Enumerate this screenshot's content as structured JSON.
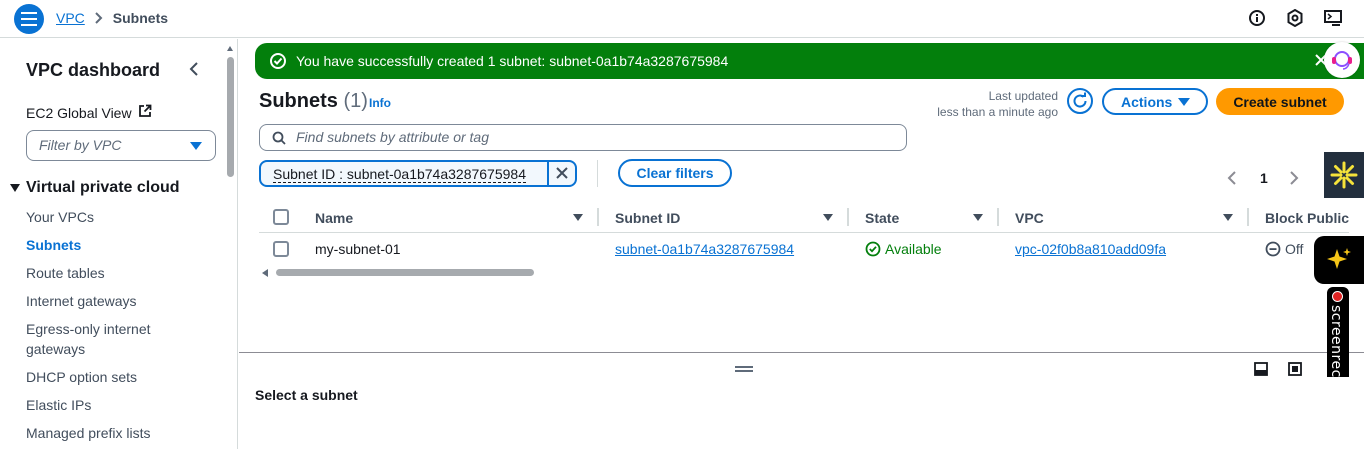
{
  "topbar": {
    "breadcrumb": {
      "root": "VPC",
      "current": "Subnets"
    },
    "icons": [
      "info-icon",
      "settings-icon",
      "cloudshell-icon"
    ]
  },
  "sidebar": {
    "title": "VPC dashboard",
    "ec2_link": "EC2 Global View",
    "filter_placeholder": "Filter by VPC",
    "section": "Virtual private cloud",
    "items": [
      {
        "label": "Your VPCs",
        "active": false
      },
      {
        "label": "Subnets",
        "active": true
      },
      {
        "label": "Route tables",
        "active": false
      },
      {
        "label": "Internet gateways",
        "active": false
      },
      {
        "label": "Egress-only internet gateways",
        "active": false
      },
      {
        "label": "DHCP option sets",
        "active": false
      },
      {
        "label": "Elastic IPs",
        "active": false
      },
      {
        "label": "Managed prefix lists",
        "active": false
      }
    ]
  },
  "flash": {
    "message": "You have successfully created 1 subnet: subnet-0a1b74a3287675984",
    "color": "#037f0c"
  },
  "header": {
    "title": "Subnets",
    "count": "(1)",
    "info": "Info",
    "last_updated_line1": "Last updated",
    "last_updated_line2": "less than a minute ago",
    "actions_label": "Actions",
    "create_label": "Create subnet"
  },
  "search": {
    "placeholder": "Find subnets by attribute or tag"
  },
  "filter_token": {
    "label": "Subnet ID : subnet-0a1b74a3287675984"
  },
  "clear_filters": "Clear filters",
  "pagination": {
    "page": "1"
  },
  "table": {
    "columns": [
      "Name",
      "Subnet ID",
      "State",
      "VPC",
      "Block Public"
    ],
    "rows": [
      {
        "name": "my-subnet-01",
        "subnet_id": "subnet-0a1b74a3287675984",
        "state": "Available",
        "vpc": "vpc-02f0b8a810add09fa",
        "block_public": "Off"
      }
    ]
  },
  "details": {
    "empty_title": "Select a subnet"
  },
  "widgets": {
    "screenrec_label": "screenrec"
  },
  "colors": {
    "accent": "#0972d3",
    "primary_button": "#ff9900",
    "success": "#037f0c"
  }
}
